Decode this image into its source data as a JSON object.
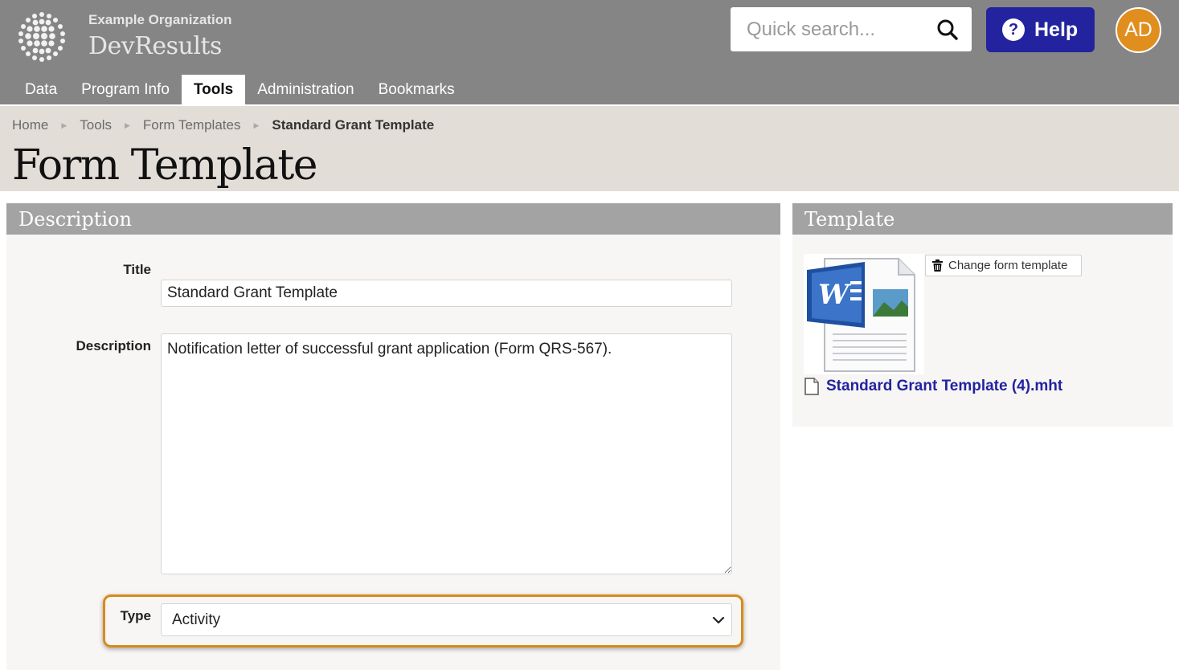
{
  "header": {
    "org_name": "Example Organization",
    "app_name": "DevResults",
    "search": {
      "placeholder": "Quick search..."
    },
    "help_label": "Help",
    "avatar_initials": "AD"
  },
  "nav": {
    "tabs": [
      {
        "label": "Data",
        "active": false
      },
      {
        "label": "Program Info",
        "active": false
      },
      {
        "label": "Tools",
        "active": true
      },
      {
        "label": "Administration",
        "active": false
      },
      {
        "label": "Bookmarks",
        "active": false
      }
    ]
  },
  "breadcrumb": [
    "Home",
    "Tools",
    "Form Templates",
    "Standard Grant Template"
  ],
  "page_title": "Form Template",
  "description_panel": {
    "heading": "Description",
    "title_label": "Title",
    "title_value": "Standard Grant Template",
    "description_label": "Description",
    "description_value": "Notification letter of successful grant application (Form QRS-567).",
    "type_label": "Type",
    "type_value": "Activity"
  },
  "template_panel": {
    "heading": "Template",
    "change_button": "Change form template",
    "file_name": "Standard Grant Template (4).mht"
  },
  "colors": {
    "header_bg": "#858585",
    "subheader_bg": "#e2ddd7",
    "accent_blue": "#2323a0",
    "avatar_orange": "#e08e1e",
    "highlight_orange": "#d98a1c"
  }
}
